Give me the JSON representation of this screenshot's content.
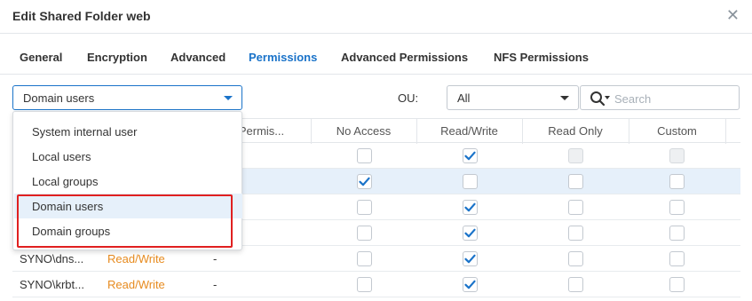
{
  "window": {
    "title": "Edit Shared Folder web"
  },
  "tabs": [
    {
      "label": "General",
      "active": false
    },
    {
      "label": "Encryption",
      "active": false
    },
    {
      "label": "Advanced",
      "active": false
    },
    {
      "label": "Permissions",
      "active": true
    },
    {
      "label": "Advanced Permissions",
      "active": false
    },
    {
      "label": "NFS Permissions",
      "active": false
    }
  ],
  "user_type_select": {
    "value": "Domain users",
    "options": [
      "System internal user",
      "Local users",
      "Local groups",
      "Domain users",
      "Domain groups"
    ],
    "selected_index": 3
  },
  "ou": {
    "label": "OU:",
    "value": "All"
  },
  "search": {
    "placeholder": "Search",
    "value": ""
  },
  "table": {
    "columns": [
      "o Permis...",
      "No Access",
      "Read/Write",
      "Read Only",
      "Custom"
    ],
    "rows": [
      {
        "name": "",
        "preview": "",
        "extra": "",
        "no_access": false,
        "read_write": true,
        "read_only": false,
        "custom": false,
        "selected": false
      },
      {
        "name": "",
        "preview": "",
        "extra": "",
        "no_access": true,
        "read_write": false,
        "read_only": false,
        "custom": false,
        "selected": true
      },
      {
        "name": "",
        "preview": "",
        "extra": "",
        "no_access": false,
        "read_write": true,
        "read_only": false,
        "custom": false,
        "selected": false
      },
      {
        "name": "",
        "preview": "",
        "extra": "",
        "no_access": false,
        "read_write": true,
        "read_only": false,
        "custom": false,
        "selected": false
      },
      {
        "name": "SYNO\\dns...",
        "preview": "Read/Write",
        "extra": "-",
        "no_access": false,
        "read_write": true,
        "read_only": false,
        "custom": false,
        "selected": false
      },
      {
        "name": "SYNO\\krbt...",
        "preview": "Read/Write",
        "extra": "-",
        "no_access": false,
        "read_write": true,
        "read_only": false,
        "custom": false,
        "selected": false
      }
    ]
  },
  "colors": {
    "accent": "#1a73c9",
    "highlight": "#e02020",
    "permission_text": "#e78b1f",
    "selected_row": "#e6f0fa"
  }
}
